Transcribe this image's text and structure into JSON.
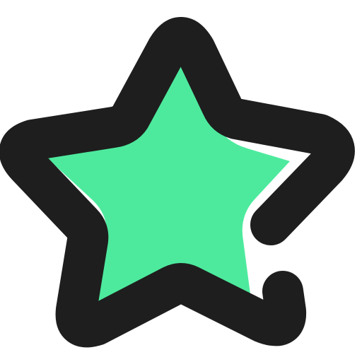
{
  "icon": {
    "name": "star-icon",
    "colors": {
      "fill": "#4DEA9D",
      "outline": "#1E1E1E",
      "gap": "#FFFFFF",
      "background": "#FFFFFF"
    }
  }
}
